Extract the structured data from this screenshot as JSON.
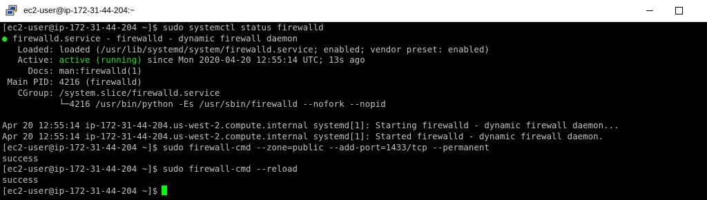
{
  "window": {
    "title": "ec2-user@ip-172-31-44-204:~"
  },
  "terminal": {
    "lines": [
      "[ec2-user@ip-172-31-44-204 ~]$ sudo systemctl status firewalld",
      " firewalld.service - firewalld - dynamic firewall daemon",
      "   Loaded: loaded (/usr/lib/systemd/system/firewalld.service; enabled; vendor preset: enabled)",
      "   Active: ",
      "     Docs: man:firewalld(1)",
      " Main PID: 4216 (firewalld)",
      "   CGroup: /system.slice/firewalld.service",
      "           └─4216 /usr/bin/python -Es /usr/sbin/firewalld --nofork --nopid",
      "",
      "Apr 20 12:55:14 ip-172-31-44-204.us-west-2.compute.internal systemd[1]: Starting firewalld - dynamic firewall daemon...",
      "Apr 20 12:55:14 ip-172-31-44-204.us-west-2.compute.internal systemd[1]: Started firewalld - dynamic firewall daemon.",
      "[ec2-user@ip-172-31-44-204 ~]$ sudo firewall-cmd --zone=public --add-port=1433/tcp --permanent",
      "success",
      "[ec2-user@ip-172-31-44-204 ~]$ sudo firewall-cmd --reload",
      "success",
      "[ec2-user@ip-172-31-44-204 ~]$"
    ],
    "status_bullet": "●",
    "active_state": "active (running)",
    "active_since": " since Mon 2020-04-20 12:55:14 UTC; 13s ago"
  },
  "colors": {
    "status_green": "#1ee31e",
    "cursor": "#00ff00",
    "text": "#c0c0c0",
    "background": "#000000"
  },
  "icons": {
    "app": "putty-icon",
    "minimize": "minimize-icon",
    "maximize": "maximize-icon"
  }
}
